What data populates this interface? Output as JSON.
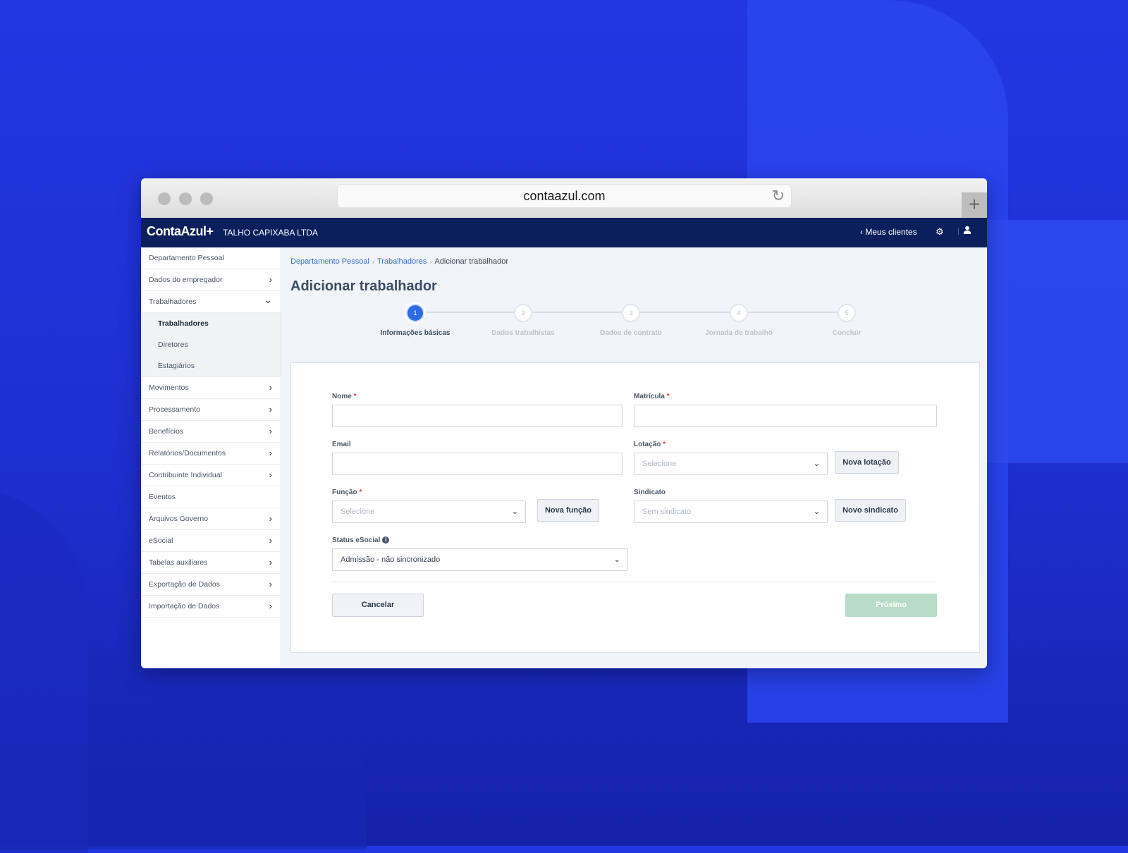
{
  "browser": {
    "url": "contaazul.com",
    "reload_icon": "reload-icon",
    "new_tab_icon": "plus-icon"
  },
  "topbar": {
    "logo": "ContaAzul+",
    "company": "TALHO CAPIXABA LTDA",
    "back_label": "Meus clientes",
    "settings_icon": "gear-icon",
    "user_icon": "user-icon"
  },
  "sidebar": {
    "items": [
      {
        "label": "Departamento Pessoal",
        "chevron": false
      },
      {
        "label": "Dados do empregador",
        "chevron": "right"
      },
      {
        "label": "Trabalhadores",
        "chevron": "down"
      },
      {
        "label": "Trabalhadores",
        "sub": true,
        "active": true
      },
      {
        "label": "Diretores",
        "sub": true
      },
      {
        "label": "Estagiários",
        "sub": true
      },
      {
        "label": "Movimentos",
        "chevron": "right"
      },
      {
        "label": "Processamento",
        "chevron": "right"
      },
      {
        "label": "Benefícios",
        "chevron": "right"
      },
      {
        "label": "Relatórios/Documentos",
        "chevron": "right"
      },
      {
        "label": "Contribuinte Individual",
        "chevron": "right"
      },
      {
        "label": "Eventos",
        "chevron": false
      },
      {
        "label": "Arquivos Governo",
        "chevron": "right"
      },
      {
        "label": "eSocial",
        "chevron": "right"
      },
      {
        "label": "Tabelas auxiliares",
        "chevron": "right"
      },
      {
        "label": "Exportação de Dados",
        "chevron": "right"
      },
      {
        "label": "Importação de Dados",
        "chevron": "right"
      }
    ]
  },
  "breadcrumb": {
    "items": [
      "Departamento Pessoal",
      "Trabalhadores",
      "Adicionar trabalhador"
    ]
  },
  "page_title": "Adicionar trabalhador",
  "stepper": {
    "current": 1,
    "steps": [
      {
        "number": "1",
        "label": "Informações básicas"
      },
      {
        "number": "2",
        "label": "Dados trabalhistas"
      },
      {
        "number": "3",
        "label": "Dados de contrato"
      },
      {
        "number": "4",
        "label": "Jornada de trabalho"
      },
      {
        "number": "5",
        "label": "Concluir"
      }
    ]
  },
  "form": {
    "nome": {
      "label": "Nome",
      "required": "*",
      "value": ""
    },
    "matricula": {
      "label": "Matrícula",
      "required": "*",
      "value": ""
    },
    "email": {
      "label": "Email",
      "value": ""
    },
    "lotacao": {
      "label": "Lotação",
      "required": "*",
      "placeholder": "Selecione",
      "button": "Nova lotação"
    },
    "funcao": {
      "label": "Função",
      "required": "*",
      "placeholder": "Selecione",
      "button": "Nova função"
    },
    "sindicato": {
      "label": "Sindicato",
      "placeholder": "Sem sindicato",
      "button": "Novo sindicato"
    },
    "status": {
      "label": "Status eSocial",
      "info_icon": "info-icon",
      "value": "Admissão - não sincronizado"
    },
    "cancel": "Cancelar",
    "next": "Próximo"
  },
  "colors": {
    "topbar": "#0b1f5c",
    "accent": "#2f6be0",
    "link": "#3a6fc8",
    "next_button_disabled": "#b8dcc7",
    "required": "#d63a3a"
  }
}
